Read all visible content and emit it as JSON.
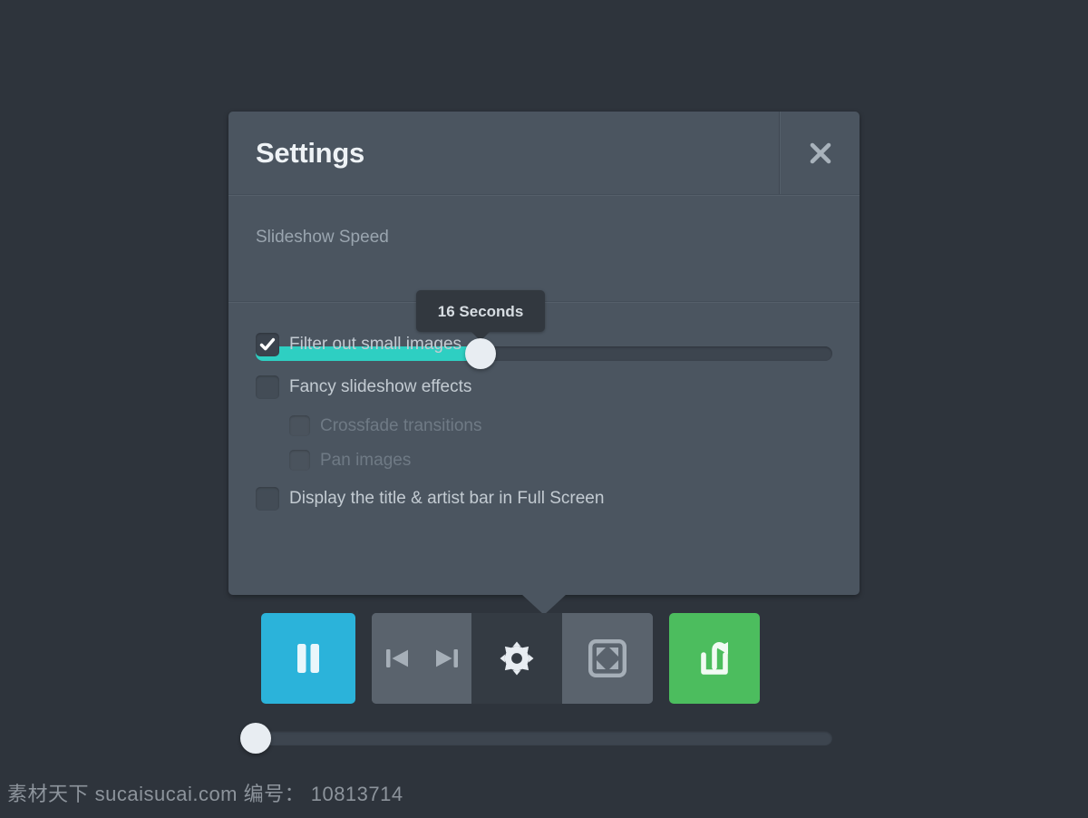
{
  "panel": {
    "title": "Settings",
    "close_icon": "close-x-icon",
    "speed": {
      "label": "Slideshow Speed",
      "tooltip_value": "16 Seconds",
      "fill_percent": 39,
      "knob_percent": 39,
      "fill_color": "#2ecfc2",
      "track_color": "#3d454f",
      "knob_color": "#e8edf2"
    },
    "options": [
      {
        "label": "Filter out small images",
        "checked": true,
        "indented": false,
        "dimmed": false
      },
      {
        "label": "Fancy slideshow effects",
        "checked": false,
        "indented": false,
        "dimmed": false
      },
      {
        "label": "Crossfade transitions",
        "checked": false,
        "indented": true,
        "dimmed": true
      },
      {
        "label": "Pan images",
        "checked": false,
        "indented": true,
        "dimmed": true
      },
      {
        "label": "Display the title & artist bar in Full Screen",
        "checked": false,
        "indented": false,
        "dimmed": false
      }
    ],
    "bottom_slider": {
      "fill_percent": 0,
      "knob_percent": 0,
      "track_color": "#3d454f",
      "knob_color": "#e8edf2"
    },
    "background_color": "#4b5560"
  },
  "toolbar": {
    "pause": {
      "name": "pause-button",
      "icon": "pause-icon",
      "color": "#2bb3da"
    },
    "previous": {
      "name": "previous-button",
      "icon": "skip-previous-icon",
      "color": "#5a636d"
    },
    "next": {
      "name": "next-button",
      "icon": "skip-next-icon",
      "color": "#5a636d"
    },
    "settings": {
      "name": "settings-button",
      "icon": "gear-icon",
      "color": "#343b43",
      "active": true
    },
    "fullscreen": {
      "name": "fullscreen-button",
      "icon": "fullscreen-icon",
      "color": "#5a636d"
    },
    "share": {
      "name": "share-button",
      "icon": "share-icon",
      "color": "#4cbd5e"
    }
  },
  "page": {
    "background_color": "#2e343c",
    "watermark": "素材天下 sucaisucai.com  编号： 10813714"
  }
}
